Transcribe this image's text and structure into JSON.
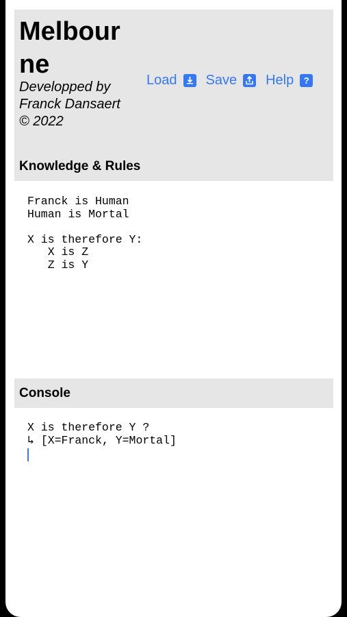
{
  "app": {
    "title": "Melbourne",
    "subtitle": "Developped by Franck Dansaert © 2022"
  },
  "toolbar": {
    "load_label": "Load",
    "save_label": "Save",
    "help_label": "Help",
    "load_icon": "download-icon",
    "save_icon": "share-icon",
    "help_icon": "question-icon"
  },
  "knowledge": {
    "header": "Knowledge & Rules",
    "content": "Franck is Human\nHuman is Mortal\n\nX is therefore Y:\n   X is Z\n   Z is Y"
  },
  "console": {
    "header": "Console",
    "lines": [
      "X is therefore Y ?",
      "↳ [X=Franck, Y=Mortal]"
    ]
  },
  "colors": {
    "accent": "#3478f6",
    "panel": "#e6e6e6"
  }
}
